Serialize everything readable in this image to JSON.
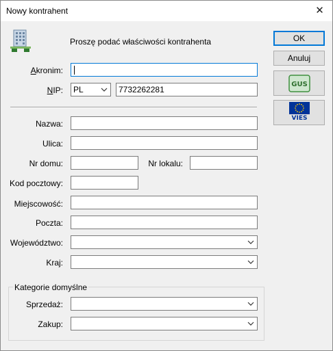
{
  "window": {
    "title": "Nowy kontrahent",
    "close_glyph": "✕"
  },
  "header": {
    "prompt": "Proszę podać właściwości kontrahenta",
    "icon": "building-icon"
  },
  "form": {
    "akronim": {
      "label_prefix": "A",
      "label_rest": "kronim:",
      "value": ""
    },
    "nip": {
      "label_prefix": "N",
      "label_rest": "IP:",
      "country": "PL",
      "value": "7732262281"
    },
    "nazwa": {
      "label": "Nazwa:",
      "value": ""
    },
    "ulica": {
      "label": "Ulica:",
      "value": ""
    },
    "nr_domu": {
      "label": "Nr domu:",
      "value": ""
    },
    "nr_lokalu": {
      "label": "Nr lokalu:",
      "value": ""
    },
    "kod_pocztowy": {
      "label": "Kod pocztowy:",
      "value": ""
    },
    "miejscowosc": {
      "label": "Miejscowość:",
      "value": ""
    },
    "poczta": {
      "label": "Poczta:",
      "value": ""
    },
    "wojewodztwo": {
      "label": "Województwo:",
      "value": ""
    },
    "kraj": {
      "label": "Kraj:",
      "value": ""
    }
  },
  "categories": {
    "title": "Kategorie domyślne",
    "sprzedaz": {
      "label": "Sprzedaż:",
      "value": ""
    },
    "zakup": {
      "label": "Zakup:",
      "value": ""
    }
  },
  "buttons": {
    "ok": "OK",
    "anuluj": "Anuluj",
    "gus": {
      "text": "GUS",
      "icon": "gus-logo-icon"
    },
    "vies": {
      "text": "VIES",
      "icon": "eu-flag-icon"
    }
  },
  "colors": {
    "accent": "#0078d7",
    "gus_green": "#3f8f3f",
    "eu_blue": "#003399",
    "eu_star": "#ffcc00"
  }
}
